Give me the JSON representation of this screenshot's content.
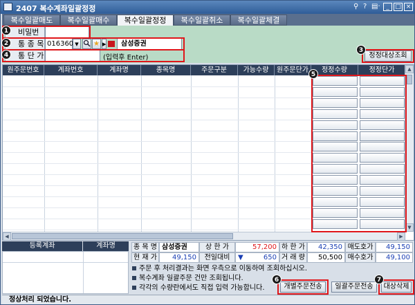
{
  "window": {
    "code": "2407",
    "title": "2407 복수계좌일괄정정",
    "controls": [
      "⚲",
      "?",
      "▤·",
      "_",
      "□",
      "×"
    ]
  },
  "tabs": [
    {
      "label": "복수일괄매도",
      "active": false
    },
    {
      "label": "복수일괄매수",
      "active": false
    },
    {
      "label": "복수일괄정정",
      "active": true
    },
    {
      "label": "복수일괄취소",
      "active": false
    },
    {
      "label": "복수일괄체결",
      "active": false
    }
  ],
  "form": {
    "password_label": "비밀번호",
    "stock_label": "통 종 목",
    "stock_code": "016360",
    "stock_name": "삼성증권",
    "price_label": "통 단 가",
    "price_hint": "(입력후 Enter)",
    "query_button": "정정대상조회"
  },
  "markers": [
    "1",
    "2",
    "3",
    "4",
    "5",
    "6",
    "7"
  ],
  "grid": {
    "columns": [
      "원주문번호",
      "계좌번호",
      "계좌명",
      "종목명",
      "주문구분",
      "가능수량",
      "원주문단가",
      "정정수량",
      "정정단가"
    ]
  },
  "bottom": {
    "acct_headers": [
      "등록계좌",
      "계좌명"
    ],
    "quote": {
      "stock_name_label": "종 목 명",
      "stock_name": "삼성증권",
      "upper_label": "상 한 가",
      "upper_value": "57,200",
      "lower_label": "하 한 가",
      "lower_value": "42,350",
      "ask_label": "매도호가",
      "ask_value": "49,150",
      "current_label": "현 재 가",
      "current_value": "49,150",
      "change_label": "전일대비",
      "change_arrow": "▼",
      "change_value": "650",
      "volume_label": "거 래 량",
      "volume_value": "50,500",
      "bid_label": "매수호가",
      "bid_value": "49,100"
    },
    "notes": [
      "주문 후 처리결과는 화면 우측으로 이동하여 조회하십시오.",
      "복수계좌 일괄주문 건만 조회됩니다.",
      "각각의 수량란에서도 직접 입력 가능합니다."
    ],
    "buttons": {
      "individual": "개별주문전송",
      "batch": "일괄주문전송",
      "clear": "대상삭제"
    }
  },
  "status": "정상처리 되었습니다.",
  "colors": {
    "header_dark": "#2d3f5a",
    "form_green": "#b9dbc6",
    "highlight_red": "#e0161a",
    "up_red": "#e0161a",
    "down_blue": "#1a3fb4"
  }
}
